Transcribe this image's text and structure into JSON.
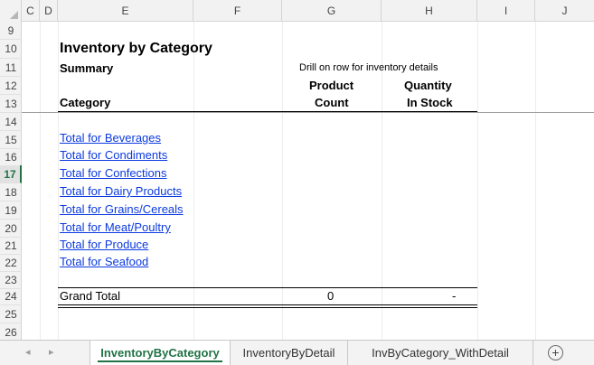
{
  "columns": [
    "C",
    "D",
    "E",
    "F",
    "G",
    "H",
    "I",
    "J"
  ],
  "rows": [
    "9",
    "10",
    "11",
    "12",
    "13",
    "14",
    "15",
    "16",
    "17",
    "18",
    "19",
    "20",
    "21",
    "22",
    "23",
    "24",
    "25",
    "26"
  ],
  "report": {
    "title": "Inventory by Category",
    "summary": "Summary",
    "drill_hint": "Drill on row for inventory details",
    "header_category": "Category",
    "header_product_line1": "Product",
    "header_product_line2": "Count",
    "header_qty_line1": "Quantity",
    "header_qty_line2": "In Stock",
    "links": [
      "Total for Beverages",
      "Total for Condiments",
      "Total for Confections",
      "Total for Dairy Products",
      "Total for Grains/Cereals",
      "Total for Meat/Poultry",
      "Total for Produce",
      "Total for Seafood"
    ],
    "grand_total_label": "Grand Total",
    "grand_total_count": "0",
    "grand_total_qty": "-"
  },
  "tabs": {
    "prev_arrow": "◂",
    "next_arrow": "▸",
    "items": [
      "InventoryByCategory",
      "InventoryByDetail",
      "InvByCategory_WithDetail"
    ],
    "active": "InventoryByCategory",
    "add": "+"
  },
  "colors": {
    "accent": "#217346",
    "link": "#0b3ae0"
  }
}
